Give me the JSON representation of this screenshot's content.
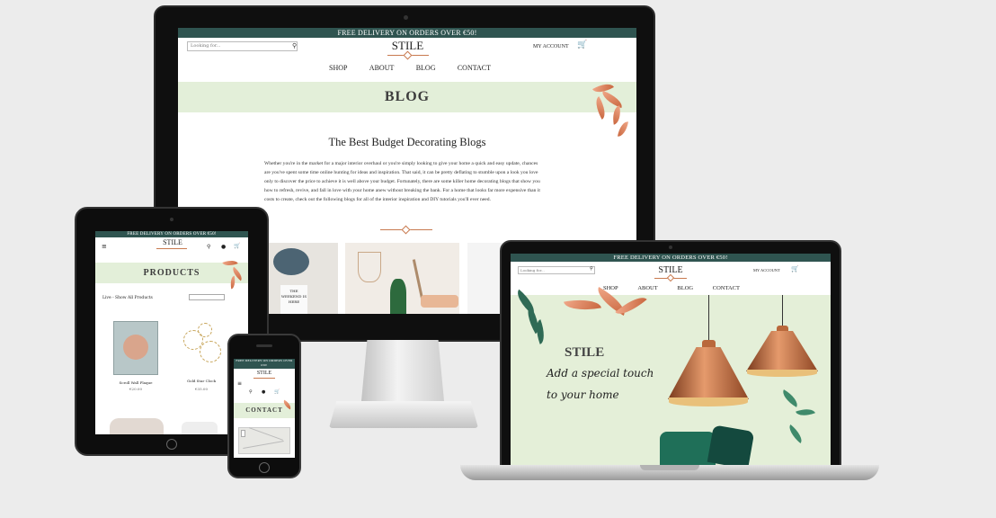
{
  "site": {
    "promo": "FREE DELIVERY ON ORDERS OVER €50!",
    "logo": "STILE",
    "search_placeholder": "Looking for...",
    "account": "MY ACCOUNT",
    "nav": [
      "SHOP",
      "ABOUT",
      "BLOG",
      "CONTACT"
    ]
  },
  "desktop": {
    "banner": "BLOG",
    "article_title": "The Best Budget Decorating Blogs",
    "article_body": "Whether you're in the market for a major interior overhaul or you're simply looking to give your home a quick and easy update, chances are you've spent some time online hunting for ideas and inspiration. That said, it can be pretty deflating to stumble upon a look you love only to discover the price to achieve it is well above your budget. Fortunately, there are some killer home decorating blogs that show you how to refresh, revive, and fall in love with your home anew without breaking the bank. For a home that looks far more expensive than it costs to create, check out the following blogs for all of the interior inspiration and DIY tutorials you'll ever need.",
    "photo_text": "THE WEEKEND IS HERE"
  },
  "tablet": {
    "banner": "PRODUCTS",
    "filter_label": "Live - Show All Products",
    "products": [
      {
        "name": "Scroll Wall Plaque",
        "price": "€20.00"
      },
      {
        "name": "Gold Star Clock",
        "price": "€35.00"
      }
    ]
  },
  "phone": {
    "banner": "CONTACT"
  },
  "laptop": {
    "hero_brand": "STILE",
    "hero_tagline_1": "Add a special touch",
    "hero_tagline_2": "to your home"
  },
  "colors": {
    "topbar": "#2f5450",
    "banner_bg": "#e3efd9",
    "accent": "#c87a4f"
  }
}
